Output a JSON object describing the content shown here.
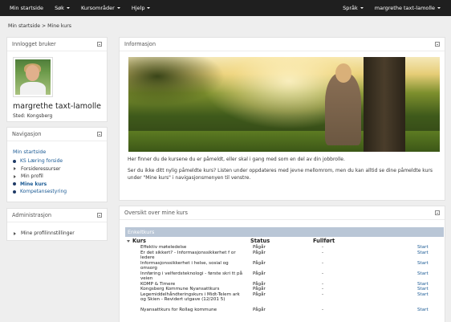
{
  "topnav": {
    "items": [
      {
        "label": "Min startside",
        "dropdown": false
      },
      {
        "label": "Søk",
        "dropdown": true
      },
      {
        "label": "Kursområder",
        "dropdown": true
      },
      {
        "label": "Hjelp",
        "dropdown": true
      }
    ],
    "language": "Språk",
    "user": "margrethe taxt-lamolle"
  },
  "breadcrumb": "Min startside > Mine kurs",
  "user_panel": {
    "title": "Innlogget bruker",
    "name": "margrethe taxt-lamolle",
    "location": "Sted: Kongsberg"
  },
  "nav_panel": {
    "title": "Navigasjon",
    "home": "Min startside",
    "items": [
      {
        "label": "KS Læring forside",
        "bullet": "dot"
      },
      {
        "label": "Forsideressurser",
        "bullet": "triangle"
      },
      {
        "label": "Min profil",
        "bullet": "triangle"
      },
      {
        "label": "Mine kurs",
        "bullet": "dot",
        "active": true
      },
      {
        "label": "Kompetansestyring",
        "bullet": "dot"
      }
    ]
  },
  "admin_panel": {
    "title": "Administrasjon",
    "item": "Mine profilinnstillinger"
  },
  "info_panel": {
    "title": "Informasjon",
    "text1": "Her finner du de kursene du er påmeldt, eller skal i gang med som en del av din jobbrolle.",
    "text2": "Ser du ikke ditt nylig påmeldte kurs? Listen under oppdateres med jevne mellomrom, men du kan alltid se dine påmeldte kurs under \"Mine kurs\" i navigasjonsmenyen til venstre."
  },
  "overview_panel": {
    "title": "Oversikt over mine kurs",
    "section": "Enkeltkurs",
    "headers": {
      "kurs": "Kurs",
      "status": "Status",
      "fullfort": "Fullført"
    },
    "rows": [
      {
        "kurs": "Effektiv møteledelse",
        "status": "Pågår",
        "fullfort": "-",
        "action": "Start"
      },
      {
        "kurs": "Er det sikkert? - Informasjonssikkerhet f or ledere",
        "status": "Pågår",
        "fullfort": "-",
        "action": "Start"
      },
      {
        "kurs": "Informasjonssikkerhet i helse, sosial og omsorg",
        "status": "Pågår",
        "fullfort": "-",
        "action": "Start"
      },
      {
        "kurs": "Innføring i velferdsteknologi - første skri tt på veien",
        "status": "Pågår",
        "fullfort": "-",
        "action": "Start"
      },
      {
        "kurs": "KOMP & Timere",
        "status": "Pågår",
        "fullfort": "-",
        "action": "Start"
      },
      {
        "kurs": "Kongsberg Kommune Nyansattkurs",
        "status": "Pågår",
        "fullfort": "-",
        "action": "Start"
      },
      {
        "kurs": "Legemiddelhåndteringskurs i Midt-Telem ark og Skien - Revidert utgave (12/201 5)",
        "status": "Pågår",
        "fullfort": "-",
        "action": "Start"
      },
      {
        "kurs": "Nyansattkurs for Rollag kommune",
        "status": "Pågår",
        "fullfort": "-",
        "action": "Start"
      }
    ]
  }
}
